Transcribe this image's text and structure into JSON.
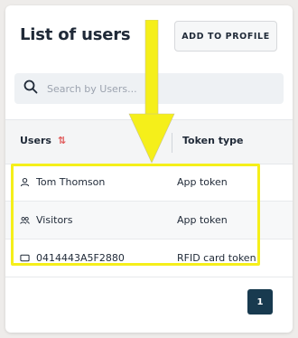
{
  "header": {
    "title": "List of users",
    "add_button_label": "ADD TO PROFILE"
  },
  "search": {
    "placeholder": "Search by Users..."
  },
  "table": {
    "columns": [
      {
        "label": "Users",
        "sort": "sort-arrows-icon"
      },
      {
        "label": "Token type"
      }
    ],
    "rows": [
      {
        "icon": "person-icon",
        "user": "Tom Thomson",
        "token": "App token"
      },
      {
        "icon": "group-icon",
        "user": "Visitors",
        "token": "App token"
      },
      {
        "icon": "card-icon",
        "user": "0414443A5F2880",
        "token": "RFID card token"
      }
    ]
  },
  "pagination": {
    "current_page": "1"
  },
  "colors": {
    "highlight": "#f5ef1a",
    "accent": "#183a4f",
    "sort_icon": "#e05a5a"
  }
}
